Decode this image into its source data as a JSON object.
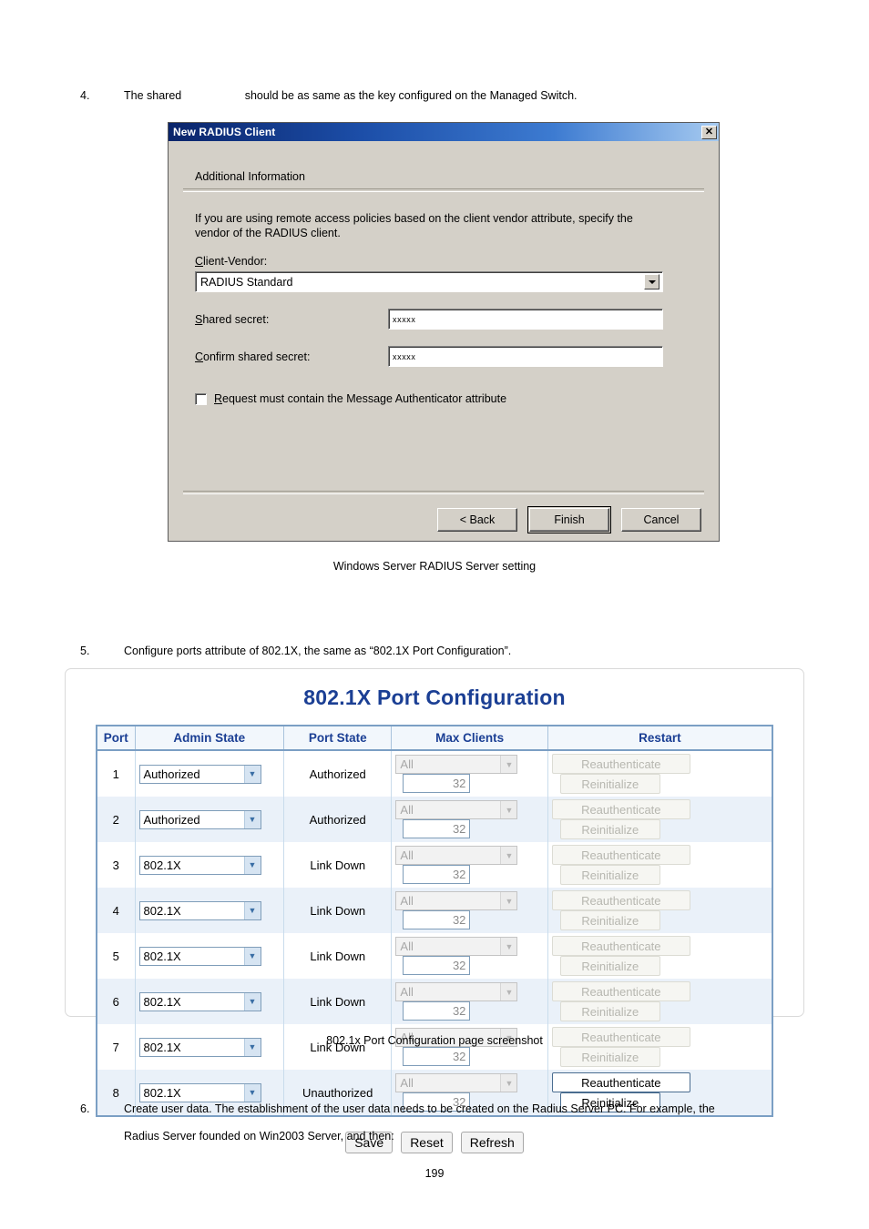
{
  "page": {
    "number": "199"
  },
  "steps": [
    {
      "num": "4.",
      "text": "The shared                    should be as same as the key configured on the Managed Switch."
    },
    {
      "num": "5.",
      "text": "Configure ports attribute of 802.1X, the same as “802.1X Port Configuration”."
    },
    {
      "num": "6.",
      "text": "Create user data. The establishment of the user data needs to be created on the Radius Server PC. For example, the\nRadius Server founded on Win2003 Server, and then:"
    }
  ],
  "captions": {
    "radius_dialog": "Windows Server RADIUS Server setting",
    "port_config": "802.1x Port Configuration page screenshot"
  },
  "radius_dialog": {
    "title": "New RADIUS Client",
    "close_label": "✕",
    "section_heading": "Additional Information",
    "intro_text": "If you are using remote access policies based on the client vendor attribute, specify the vendor of the RADIUS client.",
    "client_vendor": {
      "label_prefix": "",
      "label_accel": "C",
      "label_rest": "lient-Vendor:",
      "value": "RADIUS Standard"
    },
    "shared_secret": {
      "label_accel": "S",
      "label_rest": "hared secret:",
      "value": "xxxxx"
    },
    "confirm_secret": {
      "label_accel": "C",
      "label_rest": "onfirm shared secret:",
      "value": "xxxxx"
    },
    "message_auth": {
      "label_accel": "R",
      "label_rest": "equest must contain the Message Authenticator attribute",
      "checked": false
    },
    "buttons": {
      "back": "< Back",
      "back_accel": "B",
      "finish": "Finish",
      "cancel": "Cancel"
    }
  },
  "port_config": {
    "title": "802.1X Port Configuration",
    "columns": [
      "Port",
      "Admin State",
      "Port State",
      "Max Clients",
      "Restart"
    ],
    "rows": [
      {
        "port": "1",
        "admin_state": "Authorized",
        "port_state": "Authorized",
        "max_clients_mode": "All",
        "max_clients": "32",
        "reauth": "Reauthenticate",
        "reinit": "Reinitialize",
        "restart_enabled": false
      },
      {
        "port": "2",
        "admin_state": "Authorized",
        "port_state": "Authorized",
        "max_clients_mode": "All",
        "max_clients": "32",
        "reauth": "Reauthenticate",
        "reinit": "Reinitialize",
        "restart_enabled": false
      },
      {
        "port": "3",
        "admin_state": "802.1X",
        "port_state": "Link Down",
        "max_clients_mode": "All",
        "max_clients": "32",
        "reauth": "Reauthenticate",
        "reinit": "Reinitialize",
        "restart_enabled": false
      },
      {
        "port": "4",
        "admin_state": "802.1X",
        "port_state": "Link Down",
        "max_clients_mode": "All",
        "max_clients": "32",
        "reauth": "Reauthenticate",
        "reinit": "Reinitialize",
        "restart_enabled": false
      },
      {
        "port": "5",
        "admin_state": "802.1X",
        "port_state": "Link Down",
        "max_clients_mode": "All",
        "max_clients": "32",
        "reauth": "Reauthenticate",
        "reinit": "Reinitialize",
        "restart_enabled": false
      },
      {
        "port": "6",
        "admin_state": "802.1X",
        "port_state": "Link Down",
        "max_clients_mode": "All",
        "max_clients": "32",
        "reauth": "Reauthenticate",
        "reinit": "Reinitialize",
        "restart_enabled": false
      },
      {
        "port": "7",
        "admin_state": "802.1X",
        "port_state": "Link Down",
        "max_clients_mode": "All",
        "max_clients": "32",
        "reauth": "Reauthenticate",
        "reinit": "Reinitialize",
        "restart_enabled": false
      },
      {
        "port": "8",
        "admin_state": "802.1X",
        "port_state": "Unauthorized",
        "max_clients_mode": "All",
        "max_clients": "32",
        "reauth": "Reauthenticate",
        "reinit": "Reinitialize",
        "restart_enabled": true
      }
    ],
    "actions": [
      "Save",
      "Reset",
      "Refresh"
    ],
    "colors": {
      "title": "#1b3f94",
      "header_text": "#1b3f94",
      "header_bg": "#f2f7fc",
      "row_alt_bg": "#eaf1f9",
      "table_border": "#7b9fc4"
    }
  }
}
